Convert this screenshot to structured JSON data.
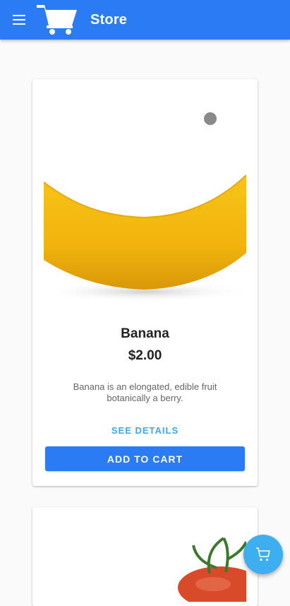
{
  "appbar": {
    "title": "Store",
    "menu_icon": "menu-icon",
    "logo_icon": "shopping-cart-icon"
  },
  "products": [
    {
      "name": "Banana",
      "price": "$2.00",
      "description": "Banana is an elongated, edible fruit botanically a berry.",
      "details_label": "SEE DETAILS",
      "add_label": "ADD TO CART"
    }
  ],
  "fab": {
    "icon": "cart-icon"
  },
  "colors": {
    "primary": "#2b7bf5",
    "accent": "#3daef0",
    "link": "#3da8e6"
  }
}
